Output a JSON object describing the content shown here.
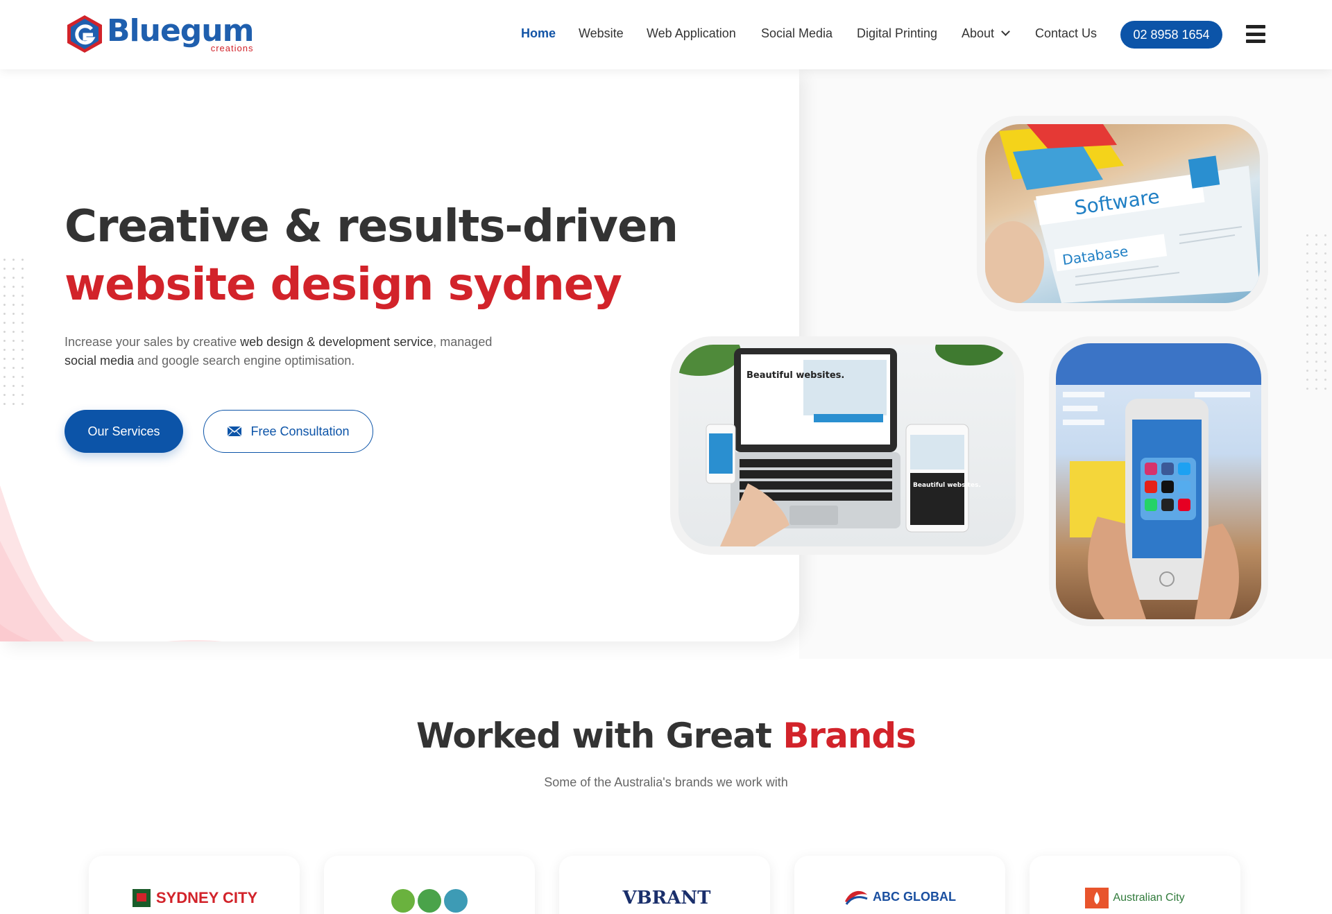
{
  "brand": {
    "name": "Bluegum",
    "sub": "creations"
  },
  "nav": {
    "items": [
      {
        "label": "Home",
        "active": true
      },
      {
        "label": "Website"
      },
      {
        "label": "Web Application"
      },
      {
        "label": "Social Media"
      },
      {
        "label": "Digital Printing"
      },
      {
        "label": "About",
        "has_dropdown": true
      },
      {
        "label": "Contact Us"
      }
    ],
    "phone": "02 8958 1654",
    "menu_icon": "hamburger-icon"
  },
  "hero": {
    "title_line1": "Creative & results-driven",
    "title_line2": "website design sydney",
    "desc_part1": "Increase your sales by creative ",
    "desc_strong1": "web design & development service",
    "desc_part2": ", managed ",
    "desc_strong2": "social media",
    "desc_part3": " and google search engine optimisation.",
    "btn_services": "Our Services",
    "btn_consult": "Free Consultation",
    "images": {
      "software_tag": "Software",
      "database_tag": "Database",
      "laptop_heading": "Beautiful websites.",
      "tablet_heading": "Beautiful websites."
    }
  },
  "brands": {
    "title_dark": "Worked with Great ",
    "title_red": "Brands",
    "subtitle": "Some of the Australia's brands we work with",
    "logos": [
      {
        "name": "SYDNEY CITY"
      },
      {
        "name": ""
      },
      {
        "name": "VBRANT"
      },
      {
        "name": "ABC GLOBAL"
      },
      {
        "name": "Australian City"
      }
    ]
  },
  "colors": {
    "primary": "#0c54a8",
    "accent": "#d2232a",
    "dark": "#333333"
  }
}
